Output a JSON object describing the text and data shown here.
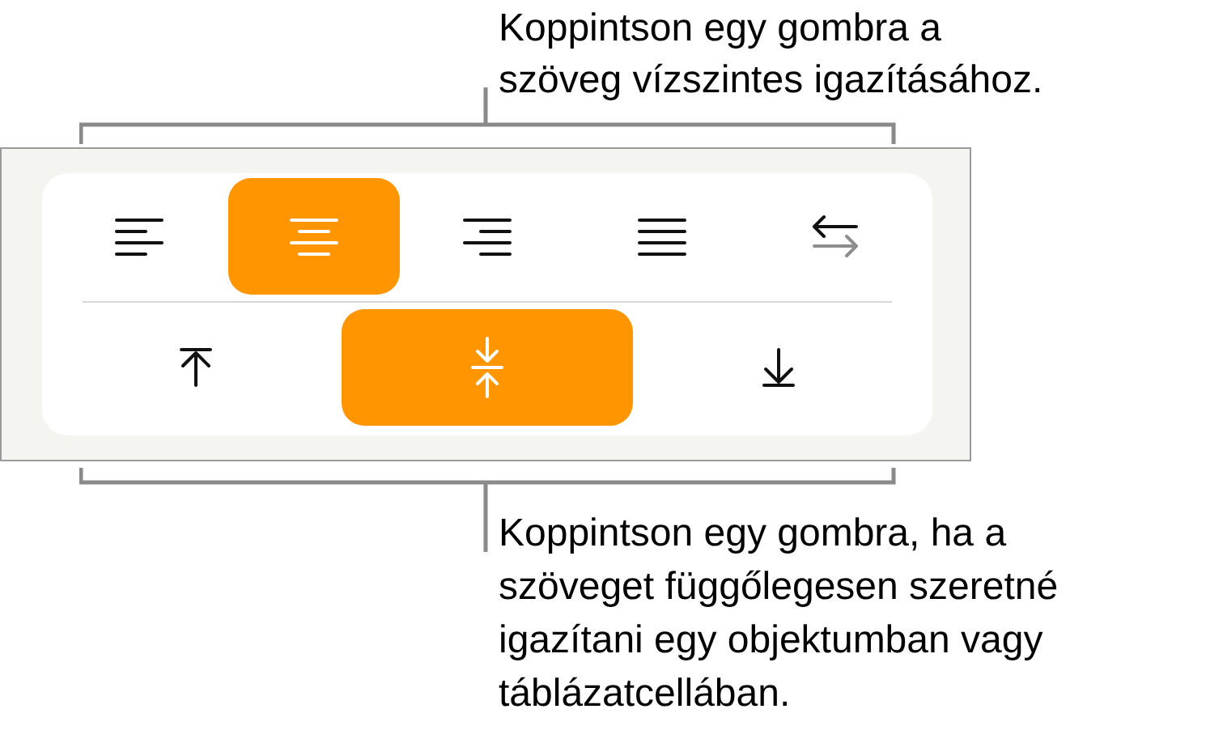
{
  "top_callout": {
    "lines": [
      "Koppintson egy gombra a",
      "szöveg vízszintes igazításához."
    ]
  },
  "horizontal_alignment": [
    {
      "kind": "left",
      "selected": false
    },
    {
      "kind": "center",
      "selected": true
    },
    {
      "kind": "right",
      "selected": false
    },
    {
      "kind": "justify",
      "selected": false
    },
    {
      "kind": "direction",
      "selected": false
    }
  ],
  "vertical_alignment": [
    {
      "kind": "top",
      "selected": false
    },
    {
      "kind": "middle",
      "selected": true
    },
    {
      "kind": "bottom",
      "selected": false
    }
  ],
  "bottom_callout": {
    "lines": [
      "Koppintson egy gombra, ha a",
      "szöveget függőlegesen szeretné",
      "igazítani egy objektumban vagy",
      "táblázatcellában."
    ]
  }
}
